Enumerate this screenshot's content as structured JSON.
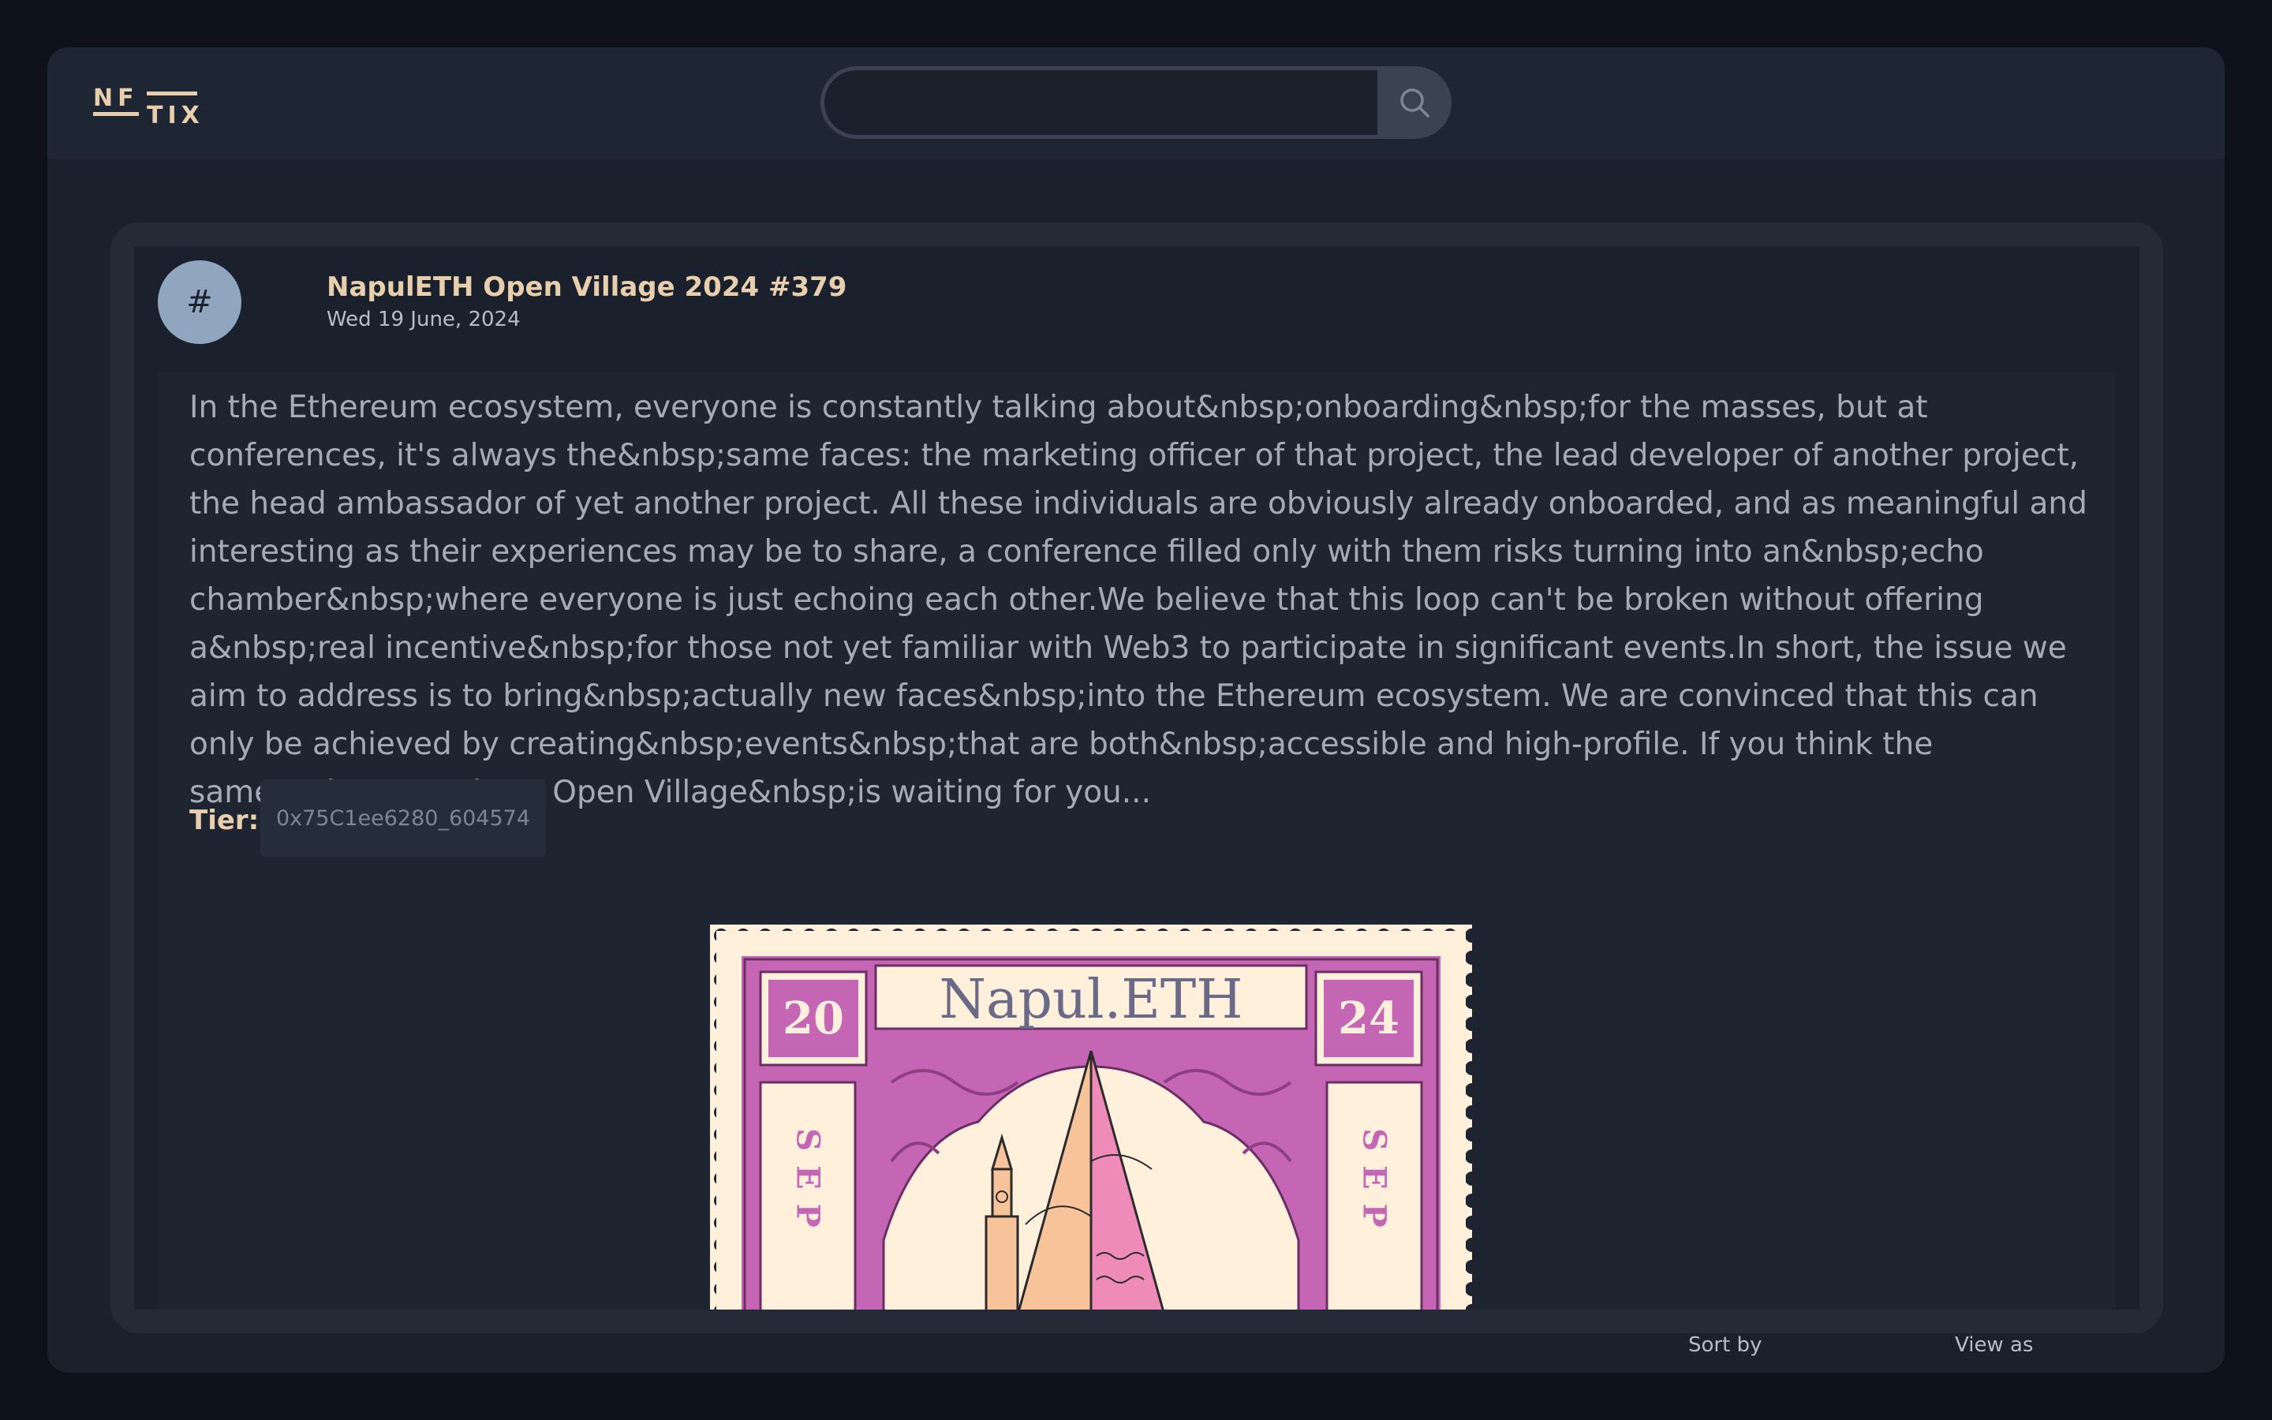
{
  "logo": {
    "text_top": "NF",
    "text_bottom": "TIX"
  },
  "search": {
    "placeholder": "",
    "value": "",
    "icon": "search-icon"
  },
  "ticket": {
    "avatar_symbol": "#",
    "title": "NapulETH Open Village 2024 #379",
    "date": "Wed 19 June, 2024",
    "description": "In the Ethereum ecosystem, everyone is constantly talking about&nbsp;onboarding&nbsp;for the masses, but at conferences, it's always the&nbsp;same faces: the marketing officer of that project, the lead developer of another project, the head ambassador of yet another project. All these individuals are obviously already onboarded, and as meaningful and interesting as their experiences may be to share, a conference filled only with them risks turning into an&nbsp;echo chamber&nbsp;where everyone is just echoing each other.We believe that this loop can't be broken without offering a&nbsp;real incentive&nbsp;for those not yet familiar with Web3 to participate in significant events.In short, the issue we aim to address is to bring&nbsp;actually new faces&nbsp;into the Ethereum ecosystem. We are convinced that this can only be achieved by creating&nbsp;events&nbsp;that are both&nbsp;accessible and high-profile. If you think the same,&nbsp;NapulETH Open Village&nbsp;is waiting for you...",
    "tier_label": "Tier:",
    "tier_value": "0x75C1ee6280_604574",
    "stamp": {
      "title": "Napul.ETH",
      "year_left": "20",
      "year_right": "24",
      "side_left": "SEP",
      "side_right": "SEP"
    }
  },
  "footer": {
    "sort_label": "Sort by",
    "view_label": "View as"
  },
  "colors": {
    "background": "#0c111b",
    "panel": "#1b212c",
    "accent_text": "#e7cfae",
    "avatar": "#90a6bf",
    "stamp_magenta": "#c566b4",
    "stamp_cream": "#fff0dc"
  }
}
